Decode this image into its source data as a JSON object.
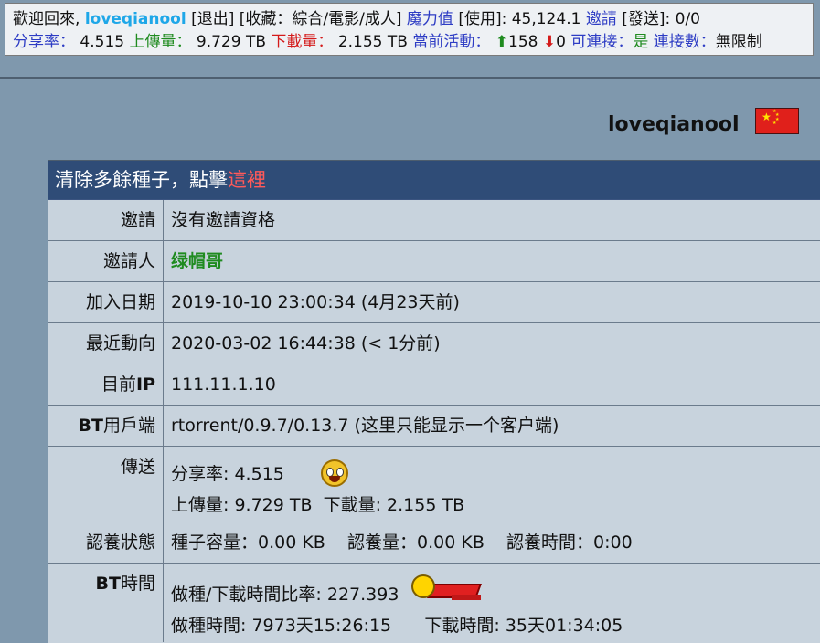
{
  "infobar": {
    "welcome": "歡迎回來, ",
    "username": "loveqianool",
    "logout": "[退出]",
    "collections": "[收藏：綜合/電影/成人]",
    "magic_label": "魔力值",
    "magic_use": "[使用]: 45,124.1",
    "invite_label": "邀請",
    "invite_send": "[發送]: 0/0",
    "ratio_label": "分享率：",
    "ratio_value": "4.515",
    "upload_label": "上傳量：",
    "upload_value": "9.729 TB",
    "download_label": "下載量：",
    "download_value": "2.155 TB",
    "active_label": "當前活動：",
    "seeding_count": "158",
    "leeching_count": "0",
    "connectable_label": "可連接：",
    "connectable_value": "是",
    "connections_label": "連接數：",
    "connections_value": "無限制"
  },
  "profile": {
    "name": "loveqianool",
    "flag": "china-flag-icon"
  },
  "notice": {
    "text": "清除多餘種子，點擊",
    "link": "這裡"
  },
  "rows": {
    "invite": {
      "label": "邀請",
      "value": "沒有邀請資格"
    },
    "inviter": {
      "label": "邀請人",
      "value": "绿帽哥"
    },
    "join_date": {
      "label": "加入日期",
      "value": "2019-10-10 23:00:34 (4月23天前)"
    },
    "last_active": {
      "label": "最近動向",
      "value": "2020-03-02 16:44:38 (< 1分前)"
    },
    "ip": {
      "label_prefix": "目前",
      "label_suffix": "IP",
      "value": "111.11.1.10"
    },
    "client": {
      "label_prefix": "BT",
      "label_suffix": "用戶端",
      "value": "rtorrent/0.9.7/0.13.7 (这里只能显示一个客户端)"
    },
    "transfer": {
      "label": "傳送",
      "ratio": "分享率: 4.515",
      "upload": "上傳量: 9.729 TB",
      "download": "下載量: 2.155 TB"
    },
    "seeding_status": {
      "label": "認養狀態",
      "size": "種子容量：0.00 KB",
      "amount": "認養量：0.00 KB",
      "time": "認養時間：0:00"
    },
    "bt_time": {
      "label_prefix": "BT",
      "label_suffix": "時間",
      "ratio_prefix": "做種",
      "ratio_suffix": "/下載時間比率: 227.393",
      "seed_time": "做種時間: 7973天15:26:15",
      "download_time": "下載時間: 35天01:34:05"
    }
  },
  "colors": {
    "background": "#7f98ad",
    "panel_header": "#2f4c77",
    "username": "#1ea7e8",
    "link_blue": "#2d3cc4",
    "inviter_green": "#1f8b1f"
  }
}
